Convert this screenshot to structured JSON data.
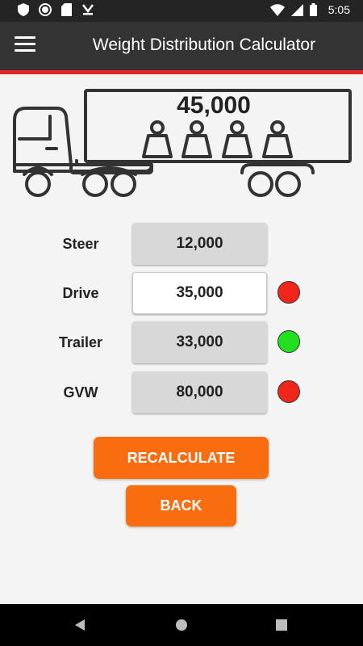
{
  "status_bar": {
    "time": "5:05",
    "left_icons": [
      "shield-icon",
      "circle-icon",
      "sd-card-icon",
      "download-icon"
    ],
    "right_icons": [
      "wifi-icon",
      "signal-icon",
      "battery-icon"
    ]
  },
  "app_bar": {
    "title": "Weight Distribution Calculator",
    "menu_icon": "hamburger-menu-icon",
    "accent_color": "#e5262a"
  },
  "diagram": {
    "load_value": "45,000"
  },
  "rows": [
    {
      "label": "Steer",
      "value": "12,000",
      "editable": false,
      "status": null
    },
    {
      "label": "Drive",
      "value": "35,000",
      "editable": true,
      "status": "red"
    },
    {
      "label": "Trailer",
      "value": "33,000",
      "editable": false,
      "status": "green"
    },
    {
      "label": "GVW",
      "value": "80,000",
      "editable": false,
      "status": "red"
    }
  ],
  "status_colors": {
    "red": "#f0261a",
    "green": "#22e01f"
  },
  "buttons": {
    "recalculate": "RECALCULATE",
    "back": "BACK",
    "color": "#f96d11"
  },
  "nav_bar": {
    "icons": [
      "back-icon",
      "home-icon",
      "recents-icon"
    ]
  }
}
